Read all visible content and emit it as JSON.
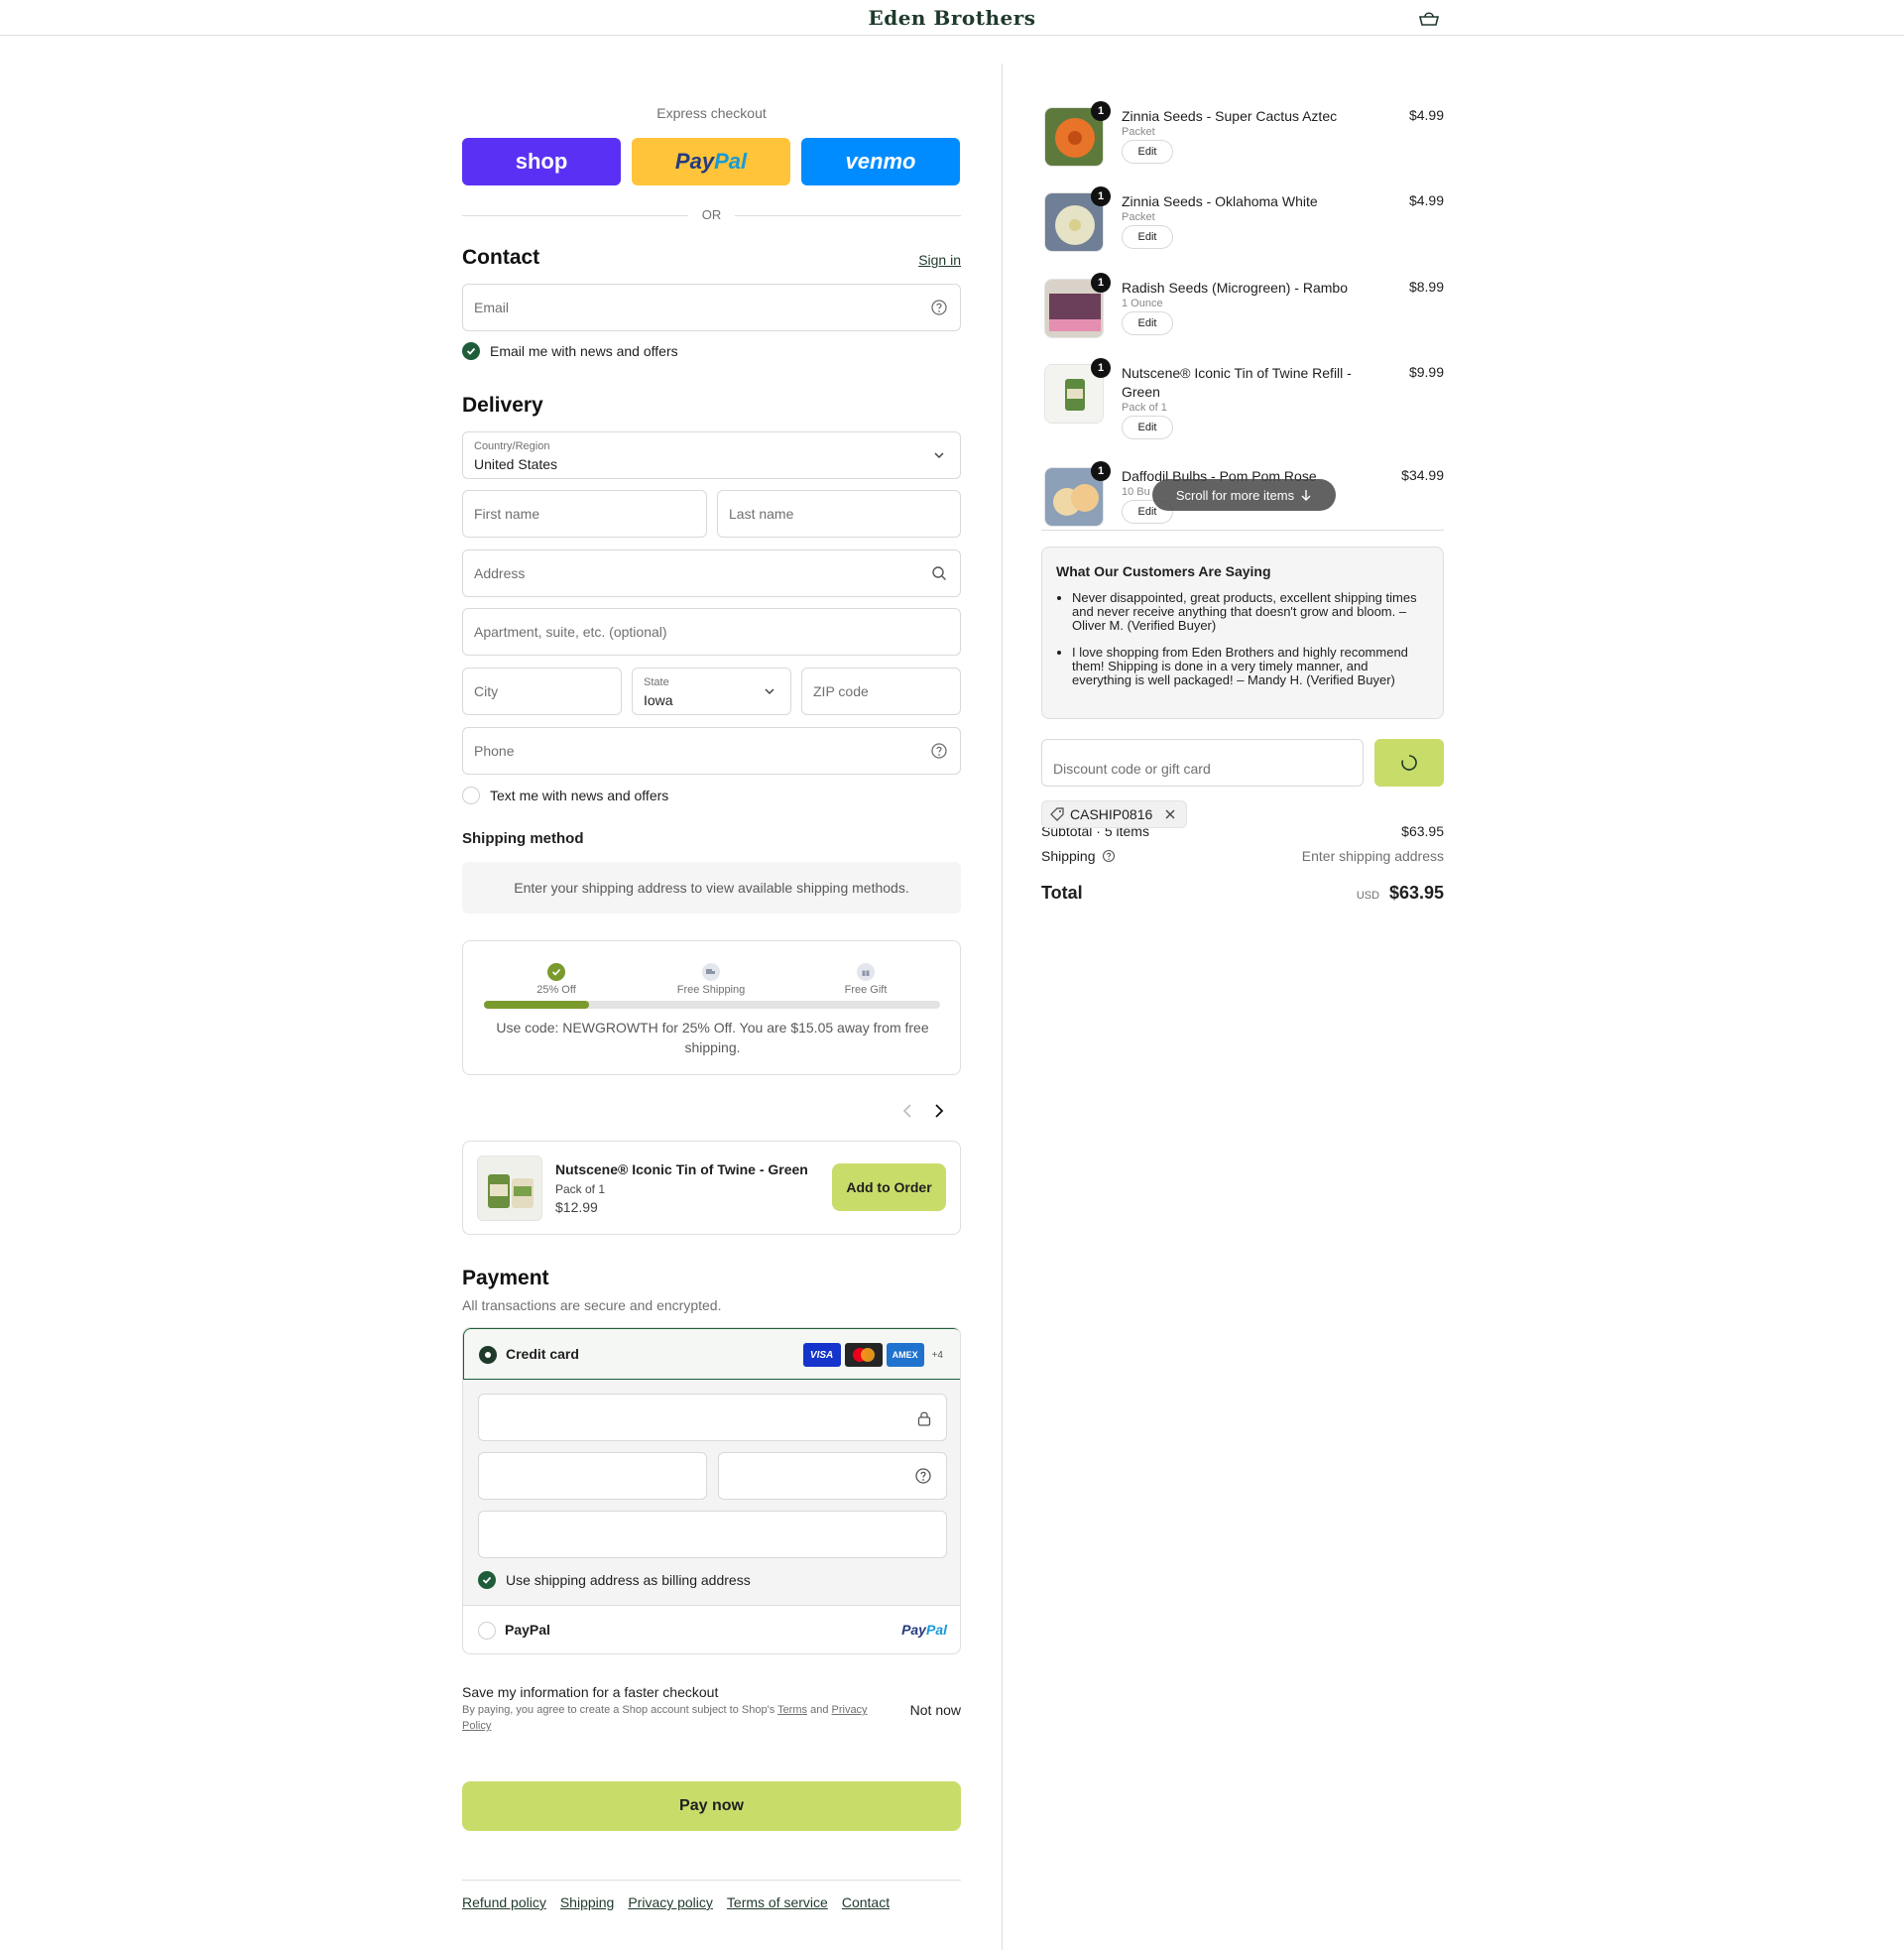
{
  "header": {
    "logo": "Eden Brothers",
    "cart_icon": "cart-icon"
  },
  "express": {
    "label": "Express checkout",
    "shop": "shop",
    "paypal_part1": "Pay",
    "paypal_part2": "Pal",
    "venmo": "venmo",
    "or": "OR"
  },
  "contact": {
    "title": "Contact",
    "sign_in": "Sign in",
    "email_placeholder": "Email",
    "newsletter_label": "Email me with news and offers",
    "newsletter_checked": true
  },
  "delivery": {
    "title": "Delivery",
    "country_label": "Country/Region",
    "country_value": "United States",
    "first_name": "First name",
    "last_name": "Last name",
    "address": "Address",
    "apartment": "Apartment, suite, etc. (optional)",
    "city": "City",
    "state_label": "State",
    "state_value": "Iowa",
    "zip": "ZIP code",
    "phone": "Phone",
    "sms_label": "Text me with news and offers",
    "sms_checked": false
  },
  "shipping_method": {
    "title": "Shipping method",
    "note": "Enter your shipping address to view available shipping methods."
  },
  "rewards": {
    "milestones": [
      "25% Off",
      "Free Shipping",
      "Free Gift"
    ],
    "progress": 0.23,
    "message": "Use code: NEWGROWTH for 25% Off. You are $15.05 away from free shipping."
  },
  "upsell": {
    "name": "Nutscene® Iconic Tin of Twine - Green",
    "variant": "Pack of 1",
    "price": "$12.99",
    "button": "Add to Order"
  },
  "payment": {
    "title": "Payment",
    "subtitle": "All transactions are secure and encrypted.",
    "credit_card_label": "Credit card",
    "card_brands": [
      "VISA",
      "Mastercard",
      "AMEX"
    ],
    "more_brands": "+4",
    "billing_label": "Use shipping address as billing address",
    "billing_checked": true,
    "paypal_label": "PayPal",
    "paypal_logo_part1": "Pay",
    "paypal_logo_part2": "Pal",
    "selected": "Credit card"
  },
  "save_info": {
    "title": "Save my information for a faster checkout",
    "legal_prefix": "By paying, you agree to create a Shop account subject to Shop's",
    "terms": "Terms",
    "and": "and",
    "privacy": "Privacy Policy",
    "not_now": "Not now"
  },
  "pay_now": "Pay now",
  "footer": {
    "links": [
      "Refund policy",
      "Shipping",
      "Privacy policy",
      "Terms of service",
      "Contact"
    ]
  },
  "order": {
    "items": [
      {
        "qty": "1",
        "name": "Zinnia Seeds - Super Cactus Aztec",
        "variant": "Packet",
        "price": "$4.99",
        "edit": "Edit",
        "color": "#e8742a"
      },
      {
        "qty": "1",
        "name": "Zinnia Seeds - Oklahoma White",
        "variant": "Packet",
        "price": "$4.99",
        "edit": "Edit",
        "color": "#e6e2c6"
      },
      {
        "qty": "1",
        "name": "Radish Seeds (Microgreen) - Rambo",
        "variant": "1 Ounce",
        "price": "$8.99",
        "edit": "Edit",
        "color": "#6b3f5a"
      },
      {
        "qty": "1",
        "name": "Nutscene® Iconic Tin of Twine Refill - Green",
        "variant": "Pack of 1",
        "price": "$9.99",
        "edit": "Edit",
        "color": "#5d8a3e"
      },
      {
        "qty": "1",
        "name": "Daffodil Bulbs - Pom Pom Rose",
        "variant": "10 Bu",
        "price": "$34.99",
        "edit": "Edit",
        "color": "#efd7a6"
      }
    ],
    "scroll_hint": "Scroll for more items",
    "reviews_title": "What Our Customers Are Saying",
    "reviews": [
      "Never disappointed, great products, excellent shipping times and never receive anything that doesn't grow and bloom. – Oliver M. (Verified Buyer)",
      "I love shopping from Eden Brothers and highly recommend them! Shipping is done in a very timely manner, and everything is well packaged! – Mandy H. (Verified Buyer)"
    ],
    "discount_placeholder": "Discount code or gift card",
    "applied_code": "CASHIP0816",
    "subtotal_label": "Subtotal · 5 items",
    "subtotal_value": "$63.95",
    "shipping_label": "Shipping",
    "shipping_value": "Enter shipping address",
    "total_label": "Total",
    "currency": "USD",
    "total_value": "$63.95"
  },
  "colors": {
    "accent": "#c8dc6a",
    "dark_green": "#1f5c3a",
    "shop": "#5a31f4",
    "paypal": "#ffc439",
    "venmo": "#008cff"
  }
}
